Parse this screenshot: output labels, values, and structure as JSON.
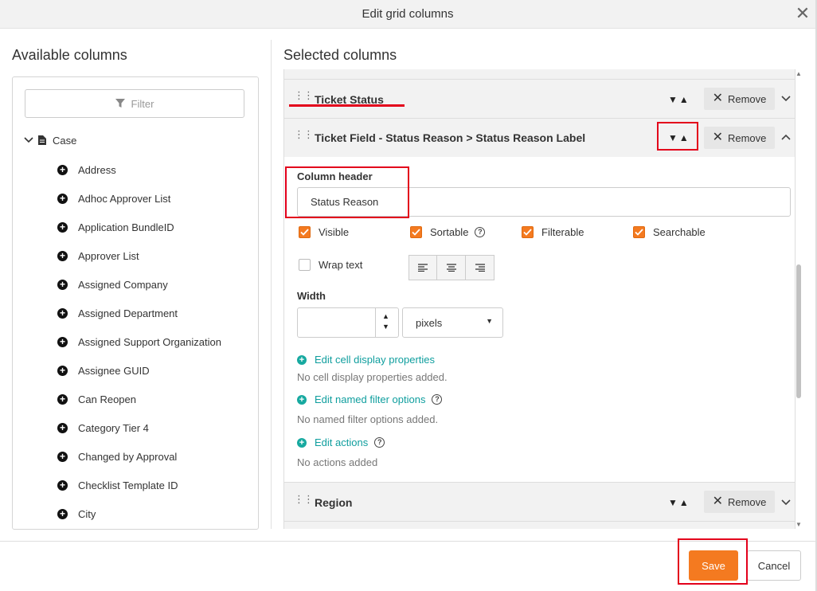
{
  "dialog": {
    "title": "Edit grid columns"
  },
  "available": {
    "title": "Available columns",
    "filter_placeholder": "Filter",
    "tree_root": "Case",
    "items": [
      "Address",
      "Adhoc Approver List",
      "Application BundleID",
      "Approver List",
      "Assigned Company",
      "Assigned Department",
      "Assigned Support Organization",
      "Assignee GUID",
      "Can Reopen",
      "Category Tier 4",
      "Changed by Approval",
      "Checklist Template ID",
      "City"
    ]
  },
  "selected": {
    "title": "Selected columns",
    "remove_label": "Remove",
    "rows": [
      {
        "label": "Ticket Status"
      },
      {
        "label": "Ticket Field - Status Reason > Status Reason Label"
      },
      {
        "label": "Region"
      }
    ],
    "editor": {
      "column_header_label": "Column header",
      "column_header_value": "Status Reason",
      "visible_label": "Visible",
      "sortable_label": "Sortable",
      "filterable_label": "Filterable",
      "searchable_label": "Searchable",
      "wrap_text_label": "Wrap text",
      "visible": true,
      "sortable": true,
      "filterable": true,
      "searchable": true,
      "wrap_text": false,
      "width_label": "Width",
      "width_value": "",
      "width_unit": "pixels",
      "cell_display_link": "Edit cell display properties",
      "cell_display_note": "No cell display properties added.",
      "named_filter_link": "Edit named filter options",
      "named_filter_note": "No named filter options added.",
      "actions_link": "Edit actions",
      "actions_note": "No actions added"
    }
  },
  "footer": {
    "save_label": "Save",
    "cancel_label": "Cancel"
  },
  "colors": {
    "accent": "#f47a20",
    "link": "#0f9e9e",
    "annotation": "#e3001b"
  }
}
